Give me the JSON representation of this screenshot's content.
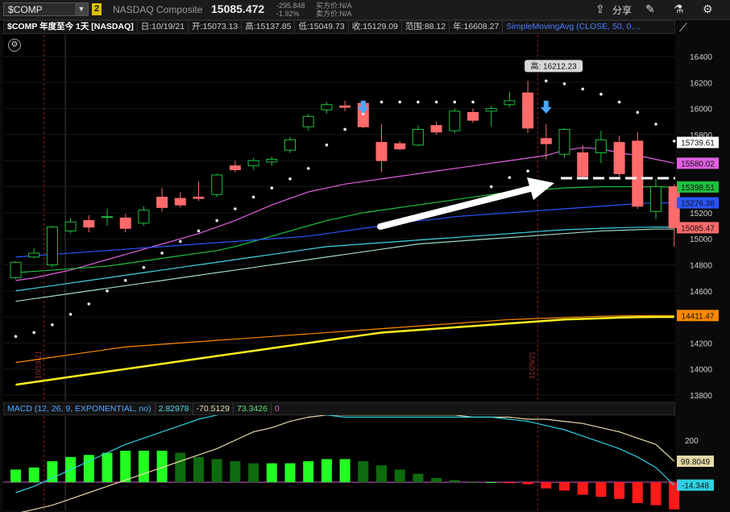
{
  "toolbar": {
    "symbol": "$COMP",
    "link_badge": "2",
    "company": "NASDAQ Composite",
    "last": "15085.472",
    "change_abs": "-295.848",
    "change_pct": "-1.92%",
    "bid": "买方价:N/A",
    "ask": "卖方价:N/A",
    "share_label": "分享"
  },
  "info": {
    "title": "$COMP 年度至今 1天 [NASDAQ]",
    "date": "日:10/19/21",
    "open": "开:15073.13",
    "high": "高:15137.85",
    "low": "低:15049.73",
    "close": "收:15129.09",
    "range": "范围:88.12",
    "year_high": "年:16608.27",
    "sma": "SimpleMovingAvg (CLOSE, 50, 0,..."
  },
  "macd": {
    "title": "MACD (12, 26, 9, EXPONENTIAL, no)",
    "value": "2.82978",
    "avg": "-70.5129",
    "diff": "73.3426",
    "zero": "0"
  },
  "annotations": {
    "high_label": "高: 16212.23"
  },
  "chart_data": [
    {
      "type": "candlestick",
      "y_axis": {
        "ticks": [
          "16400",
          "16200",
          "16000",
          "15800",
          "15600",
          "15400",
          "15200",
          "15000",
          "14800",
          "14600",
          "14400",
          "14200",
          "14000",
          "13800"
        ],
        "min": 13800,
        "max": 16400
      },
      "date_markers": [
        {
          "label": "10/19/21",
          "index": 0
        },
        {
          "label": "11/29/21",
          "index": 27
        }
      ],
      "price_labels": [
        {
          "text": "15739.61",
          "value": 15740,
          "color": "#ffffff"
        },
        {
          "text": "15580.02",
          "value": 15580,
          "color": "#e060e0"
        },
        {
          "text": "15398.51",
          "value": 15398,
          "color": "#1fbf3f"
        },
        {
          "text": "15276.38",
          "value": 15276,
          "color": "#2a55ff"
        },
        {
          "text": "15085.47",
          "value": 15085,
          "color": "#ff6b6b"
        },
        {
          "text": "14411.47",
          "value": 14411,
          "color": "#ff8800"
        }
      ],
      "candles": [
        {
          "o": 14700,
          "h": 14830,
          "l": 14690,
          "c": 14820
        },
        {
          "o": 14860,
          "h": 14930,
          "l": 14850,
          "c": 14890
        },
        {
          "o": 14800,
          "h": 15100,
          "l": 14780,
          "c": 15090
        },
        {
          "o": 15060,
          "h": 15160,
          "l": 15040,
          "c": 15130
        },
        {
          "o": 15140,
          "h": 15180,
          "l": 15050,
          "c": 15090
        },
        {
          "o": 15170,
          "h": 15230,
          "l": 15100,
          "c": 15170
        },
        {
          "o": 15160,
          "h": 15190,
          "l": 15050,
          "c": 15080
        },
        {
          "o": 15120,
          "h": 15250,
          "l": 15100,
          "c": 15220
        },
        {
          "o": 15320,
          "h": 15390,
          "l": 15210,
          "c": 15240
        },
        {
          "o": 15310,
          "h": 15360,
          "l": 15240,
          "c": 15260
        },
        {
          "o": 15320,
          "h": 15440,
          "l": 15290,
          "c": 15310
        },
        {
          "o": 15340,
          "h": 15500,
          "l": 15320,
          "c": 15490
        },
        {
          "o": 15560,
          "h": 15600,
          "l": 15510,
          "c": 15530
        },
        {
          "o": 15560,
          "h": 15620,
          "l": 15530,
          "c": 15600
        },
        {
          "o": 15590,
          "h": 15630,
          "l": 15560,
          "c": 15610
        },
        {
          "o": 15680,
          "h": 15780,
          "l": 15660,
          "c": 15760
        },
        {
          "o": 15860,
          "h": 15960,
          "l": 15830,
          "c": 15940
        },
        {
          "o": 15990,
          "h": 16050,
          "l": 15960,
          "c": 16030
        },
        {
          "o": 16020,
          "h": 16060,
          "l": 15980,
          "c": 16010
        },
        {
          "o": 16040,
          "h": 16050,
          "l": 15850,
          "c": 15860
        },
        {
          "o": 15740,
          "h": 15880,
          "l": 15510,
          "c": 15600
        },
        {
          "o": 15730,
          "h": 15750,
          "l": 15680,
          "c": 15690
        },
        {
          "o": 15720,
          "h": 15870,
          "l": 15710,
          "c": 15840
        },
        {
          "o": 15870,
          "h": 15900,
          "l": 15800,
          "c": 15820
        },
        {
          "o": 15830,
          "h": 16000,
          "l": 15810,
          "c": 15980
        },
        {
          "o": 15970,
          "h": 16000,
          "l": 15890,
          "c": 15910
        },
        {
          "o": 15980,
          "h": 16020,
          "l": 15860,
          "c": 16000
        },
        {
          "o": 16030,
          "h": 16130,
          "l": 16010,
          "c": 16060
        },
        {
          "o": 16120,
          "h": 16212,
          "l": 15810,
          "c": 15850
        },
        {
          "o": 15770,
          "h": 15880,
          "l": 15610,
          "c": 15730
        },
        {
          "o": 15650,
          "h": 15850,
          "l": 15620,
          "c": 15840
        },
        {
          "o": 15660,
          "h": 15720,
          "l": 15460,
          "c": 15480
        },
        {
          "o": 15660,
          "h": 15830,
          "l": 15580,
          "c": 15760
        },
        {
          "o": 15740,
          "h": 15790,
          "l": 15480,
          "c": 15500
        },
        {
          "o": 15750,
          "h": 15820,
          "l": 15230,
          "c": 15250
        },
        {
          "o": 15210,
          "h": 15460,
          "l": 15150,
          "c": 15400
        },
        {
          "o": 15400,
          "h": 15420,
          "l": 14940,
          "c": 15085
        }
      ],
      "parabolic_sar": [
        14250,
        14280,
        14340,
        14420,
        14500,
        14600,
        14680,
        14780,
        14890,
        14980,
        15060,
        15140,
        15230,
        15320,
        15390,
        15460,
        15540,
        15720,
        15840,
        15960,
        16050,
        16050,
        16050,
        16050,
        16050,
        16050,
        15400,
        15470,
        15520,
        16212,
        16190,
        16150,
        16110,
        16050,
        15970,
        15880,
        15750
      ],
      "moving_averages": [
        {
          "period": 5,
          "color": "#e060e0",
          "values": [
            14680,
            14700,
            14730,
            14760,
            14800,
            14840,
            14880,
            14920,
            14960,
            15000,
            15040,
            15090,
            15140,
            15200,
            15260,
            15310,
            15360,
            15390,
            15420,
            15440,
            15460,
            15480,
            15500,
            15520,
            15540,
            15560,
            15580,
            15600,
            15620,
            15640,
            15680,
            15700,
            15690,
            15660,
            15640,
            15610,
            15580
          ]
        },
        {
          "period": 50,
          "color": "#1fbf3f",
          "values": [
            14740,
            14750,
            14760,
            14770,
            14780,
            14790,
            14810,
            14830,
            14850,
            14870,
            14890,
            14910,
            14940,
            14980,
            15020,
            15060,
            15100,
            15140,
            15170,
            15200,
            15220,
            15240,
            15260,
            15280,
            15300,
            15320,
            15340,
            15360,
            15370,
            15380,
            15390,
            15395,
            15400,
            15400,
            15400,
            15398,
            15398
          ]
        },
        {
          "period": 20,
          "color": "#2a55ff",
          "values": [
            14860,
            14870,
            14880,
            14890,
            14900,
            14910,
            14920,
            14930,
            14940,
            14950,
            14960,
            14970,
            14980,
            14990,
            15000,
            15010,
            15020,
            15040,
            15060,
            15080,
            15100,
            15120,
            15140,
            15150,
            15170,
            15180,
            15190,
            15200,
            15210,
            15220,
            15230,
            15240,
            15250,
            15260,
            15270,
            15276,
            15276
          ]
        },
        {
          "period": 100,
          "color": "#3ed6e6",
          "values": [
            14600,
            14620,
            14640,
            14660,
            14680,
            14700,
            14720,
            14740,
            14760,
            14780,
            14800,
            14820,
            14840,
            14860,
            14880,
            14900,
            14920,
            14940,
            14950,
            14960,
            14970,
            14980,
            14990,
            15000,
            15010,
            15020,
            15030,
            15040,
            15050,
            15060,
            15070,
            15075,
            15080,
            15085,
            15088,
            15090,
            15090
          ]
        },
        {
          "period": 150,
          "color": "#9fd9c4",
          "values": [
            14520,
            14540,
            14560,
            14580,
            14600,
            14620,
            14640,
            14660,
            14680,
            14700,
            14720,
            14740,
            14760,
            14780,
            14800,
            14820,
            14840,
            14860,
            14880,
            14900,
            14920,
            14940,
            14960,
            14970,
            14980,
            14990,
            15000,
            15010,
            15020,
            15030,
            15040,
            15050,
            15060,
            15065,
            15070,
            15075,
            15075
          ]
        },
        {
          "period": 200,
          "color": "#ff8800",
          "values": [
            14050,
            14070,
            14090,
            14110,
            14130,
            14150,
            14170,
            14180,
            14190,
            14200,
            14210,
            14220,
            14230,
            14240,
            14250,
            14260,
            14270,
            14280,
            14290,
            14300,
            14310,
            14320,
            14330,
            14340,
            14350,
            14360,
            14370,
            14380,
            14385,
            14390,
            14395,
            14400,
            14405,
            14408,
            14410,
            14411,
            14411
          ]
        },
        {
          "period": 250,
          "color": "#ffef20",
          "values": [
            13880,
            13900,
            13920,
            13940,
            13960,
            13980,
            14000,
            14020,
            14040,
            14060,
            14080,
            14100,
            14120,
            14140,
            14160,
            14180,
            14200,
            14220,
            14240,
            14260,
            14280,
            14290,
            14300,
            14310,
            14320,
            14330,
            14340,
            14350,
            14360,
            14370,
            14380,
            14385,
            14390,
            14395,
            14398,
            14400,
            14400
          ]
        }
      ]
    },
    {
      "type": "macd",
      "y_axis": {
        "ticks": [
          "200",
          "0"
        ],
        "min": -200,
        "max": 400
      },
      "labels": [
        {
          "text": "99.8049",
          "value": 100,
          "color": "#e6d9a8"
        },
        {
          "text": "-14.348",
          "value": -14,
          "color": "#2fd0e0"
        }
      ],
      "macd_line": [
        -50,
        -20,
        20,
        60,
        100,
        140,
        180,
        210,
        240,
        270,
        300,
        320,
        340,
        350,
        350,
        340,
        330,
        320,
        310,
        310,
        310,
        310,
        310,
        310,
        310,
        310,
        310,
        300,
        290,
        270,
        250,
        220,
        190,
        160,
        120,
        70,
        -14
      ],
      "signal_line": [
        -150,
        -130,
        -110,
        -80,
        -50,
        -20,
        10,
        40,
        70,
        100,
        130,
        160,
        200,
        240,
        260,
        290,
        310,
        320,
        320,
        320,
        320,
        320,
        320,
        320,
        320,
        310,
        310,
        310,
        300,
        300,
        290,
        280,
        260,
        240,
        210,
        180,
        100
      ],
      "histogram": [
        60,
        70,
        100,
        120,
        130,
        140,
        150,
        150,
        150,
        140,
        120,
        110,
        100,
        90,
        90,
        90,
        100,
        110,
        110,
        100,
        80,
        60,
        40,
        20,
        10,
        0,
        0,
        -5,
        -10,
        -30,
        -40,
        -60,
        -70,
        -80,
        -100,
        -110,
        -130
      ]
    }
  ]
}
